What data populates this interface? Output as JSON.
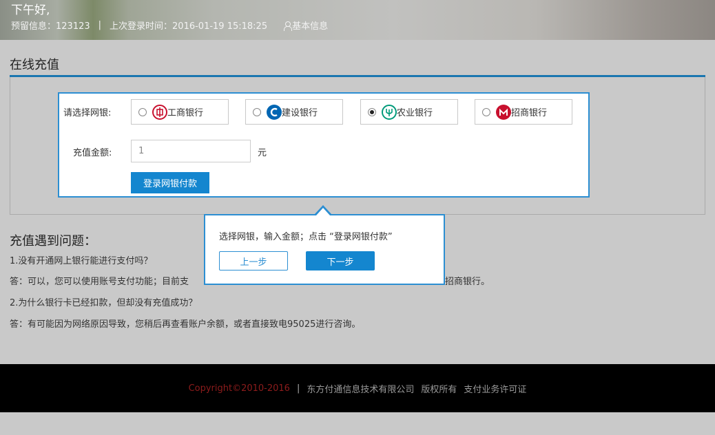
{
  "header": {
    "greeting": "下午好,",
    "reserved_info": "预留信息：123123",
    "separator": "|",
    "last_login": "上次登录时间：2016-01-19 15:18:25",
    "basic_info_link": "基本信息"
  },
  "main": {
    "section_title": "在线充值",
    "bank_select_label": "请选择网银:",
    "banks": [
      {
        "name": "工商银行",
        "checked": false,
        "icon": "icbc-logo-icon",
        "color": "#c8102e"
      },
      {
        "name": "建设银行",
        "checked": false,
        "icon": "ccb-logo-icon",
        "color": "#0066b3"
      },
      {
        "name": "农业银行",
        "checked": true,
        "icon": "abc-logo-icon",
        "color": "#009a7a"
      },
      {
        "name": "招商银行",
        "checked": false,
        "icon": "cmb-logo-icon",
        "color": "#c8102e"
      }
    ],
    "amount_label": "充值金额:",
    "amount_value": "1",
    "amount_unit": "元",
    "pay_button": "登录网银付款"
  },
  "tooltip": {
    "text": "选择网银，输入金额；点击 “登录网银付款”",
    "prev_button": "上一步",
    "next_button": "下一步"
  },
  "faq": {
    "title": "充值遇到问题：",
    "q1": "1.没有开通网上银行能进行支付吗？",
    "a1_start": "答：可以，您可以使用账号支付功能；目前支",
    "a1_end": "招商银行。",
    "q2": "2.为什么银行卡已经扣款，但却没有充值成功？",
    "a2": "答：有可能因为网络原因导致，您稍后再查看账户余额，或者直接致电95025进行咨询。"
  },
  "footer": {
    "copyright": "Copyright©2010-2016",
    "separator": "|",
    "company": "东方付通信息技术有限公司",
    "rights": "版权所有",
    "license": "支付业务许可证"
  },
  "colors": {
    "accent": "#1486cf",
    "border_blue": "#2b8ed2",
    "copyright_red": "#8e1c1c"
  }
}
